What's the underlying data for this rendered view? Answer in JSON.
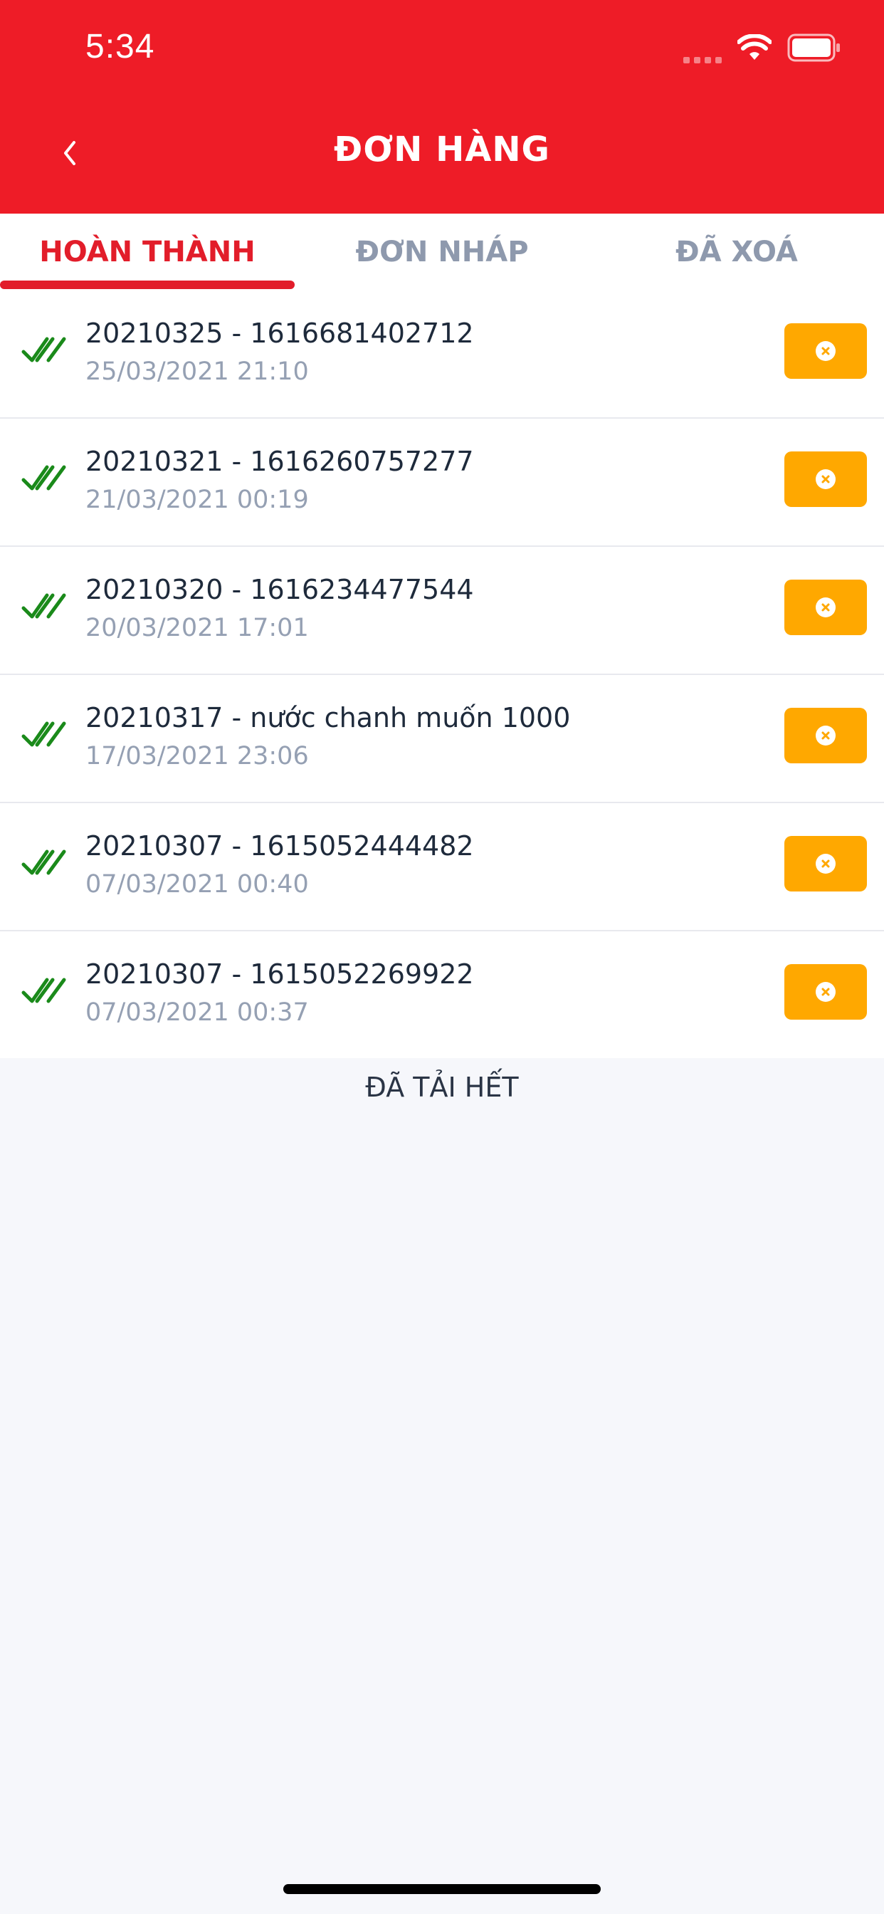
{
  "status_bar": {
    "time": "5:34"
  },
  "nav": {
    "title": "ĐƠN HÀNG"
  },
  "tabs": [
    {
      "label": "HOÀN THÀNH",
      "active": true
    },
    {
      "label": "ĐƠN NHÁP",
      "active": false
    },
    {
      "label": "ĐÃ XOÁ",
      "active": false
    }
  ],
  "orders": [
    {
      "title": "20210325 - 1616681402712",
      "date": "25/03/2021 21:10"
    },
    {
      "title": "20210321 - 1616260757277",
      "date": "21/03/2021 00:19"
    },
    {
      "title": "20210320 - 1616234477544",
      "date": "20/03/2021 17:01"
    },
    {
      "title": "20210317 - nước chanh muốn 1000",
      "date": "17/03/2021 23:06"
    },
    {
      "title": "20210307 - 1615052444482",
      "date": "07/03/2021 00:40"
    },
    {
      "title": "20210307 - 1615052269922",
      "date": "07/03/2021 00:37"
    }
  ],
  "footer": {
    "loaded_all": "ĐÃ TẢI HẾT"
  },
  "icons": {
    "status": [
      "wifi-icon",
      "battery-icon"
    ],
    "back": "chevron-left-icon",
    "row_status": "double-check-icon",
    "row_action": "close-circle-icon"
  },
  "colors": {
    "header": "#ee1c27",
    "tab_active": "#e21d2a",
    "tab_inactive": "#8e99ad",
    "check": "#1a8a1a",
    "action": "#ffa800",
    "background": "#f6f7fb"
  }
}
